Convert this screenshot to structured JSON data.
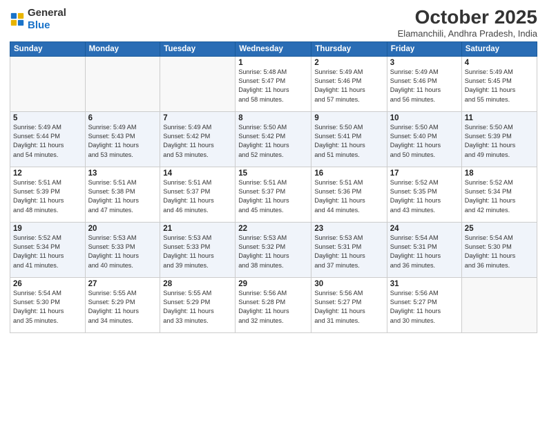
{
  "logo": {
    "general": "General",
    "blue": "Blue"
  },
  "title": "October 2025",
  "subtitle": "Elamanchili, Andhra Pradesh, India",
  "weekdays": [
    "Sunday",
    "Monday",
    "Tuesday",
    "Wednesday",
    "Thursday",
    "Friday",
    "Saturday"
  ],
  "weeks": [
    [
      {
        "day": "",
        "info": ""
      },
      {
        "day": "",
        "info": ""
      },
      {
        "day": "",
        "info": ""
      },
      {
        "day": "1",
        "info": "Sunrise: 5:48 AM\nSunset: 5:47 PM\nDaylight: 11 hours\nand 58 minutes."
      },
      {
        "day": "2",
        "info": "Sunrise: 5:49 AM\nSunset: 5:46 PM\nDaylight: 11 hours\nand 57 minutes."
      },
      {
        "day": "3",
        "info": "Sunrise: 5:49 AM\nSunset: 5:46 PM\nDaylight: 11 hours\nand 56 minutes."
      },
      {
        "day": "4",
        "info": "Sunrise: 5:49 AM\nSunset: 5:45 PM\nDaylight: 11 hours\nand 55 minutes."
      }
    ],
    [
      {
        "day": "5",
        "info": "Sunrise: 5:49 AM\nSunset: 5:44 PM\nDaylight: 11 hours\nand 54 minutes."
      },
      {
        "day": "6",
        "info": "Sunrise: 5:49 AM\nSunset: 5:43 PM\nDaylight: 11 hours\nand 53 minutes."
      },
      {
        "day": "7",
        "info": "Sunrise: 5:49 AM\nSunset: 5:42 PM\nDaylight: 11 hours\nand 53 minutes."
      },
      {
        "day": "8",
        "info": "Sunrise: 5:50 AM\nSunset: 5:42 PM\nDaylight: 11 hours\nand 52 minutes."
      },
      {
        "day": "9",
        "info": "Sunrise: 5:50 AM\nSunset: 5:41 PM\nDaylight: 11 hours\nand 51 minutes."
      },
      {
        "day": "10",
        "info": "Sunrise: 5:50 AM\nSunset: 5:40 PM\nDaylight: 11 hours\nand 50 minutes."
      },
      {
        "day": "11",
        "info": "Sunrise: 5:50 AM\nSunset: 5:39 PM\nDaylight: 11 hours\nand 49 minutes."
      }
    ],
    [
      {
        "day": "12",
        "info": "Sunrise: 5:51 AM\nSunset: 5:39 PM\nDaylight: 11 hours\nand 48 minutes."
      },
      {
        "day": "13",
        "info": "Sunrise: 5:51 AM\nSunset: 5:38 PM\nDaylight: 11 hours\nand 47 minutes."
      },
      {
        "day": "14",
        "info": "Sunrise: 5:51 AM\nSunset: 5:37 PM\nDaylight: 11 hours\nand 46 minutes."
      },
      {
        "day": "15",
        "info": "Sunrise: 5:51 AM\nSunset: 5:37 PM\nDaylight: 11 hours\nand 45 minutes."
      },
      {
        "day": "16",
        "info": "Sunrise: 5:51 AM\nSunset: 5:36 PM\nDaylight: 11 hours\nand 44 minutes."
      },
      {
        "day": "17",
        "info": "Sunrise: 5:52 AM\nSunset: 5:35 PM\nDaylight: 11 hours\nand 43 minutes."
      },
      {
        "day": "18",
        "info": "Sunrise: 5:52 AM\nSunset: 5:34 PM\nDaylight: 11 hours\nand 42 minutes."
      }
    ],
    [
      {
        "day": "19",
        "info": "Sunrise: 5:52 AM\nSunset: 5:34 PM\nDaylight: 11 hours\nand 41 minutes."
      },
      {
        "day": "20",
        "info": "Sunrise: 5:53 AM\nSunset: 5:33 PM\nDaylight: 11 hours\nand 40 minutes."
      },
      {
        "day": "21",
        "info": "Sunrise: 5:53 AM\nSunset: 5:33 PM\nDaylight: 11 hours\nand 39 minutes."
      },
      {
        "day": "22",
        "info": "Sunrise: 5:53 AM\nSunset: 5:32 PM\nDaylight: 11 hours\nand 38 minutes."
      },
      {
        "day": "23",
        "info": "Sunrise: 5:53 AM\nSunset: 5:31 PM\nDaylight: 11 hours\nand 37 minutes."
      },
      {
        "day": "24",
        "info": "Sunrise: 5:54 AM\nSunset: 5:31 PM\nDaylight: 11 hours\nand 36 minutes."
      },
      {
        "day": "25",
        "info": "Sunrise: 5:54 AM\nSunset: 5:30 PM\nDaylight: 11 hours\nand 36 minutes."
      }
    ],
    [
      {
        "day": "26",
        "info": "Sunrise: 5:54 AM\nSunset: 5:30 PM\nDaylight: 11 hours\nand 35 minutes."
      },
      {
        "day": "27",
        "info": "Sunrise: 5:55 AM\nSunset: 5:29 PM\nDaylight: 11 hours\nand 34 minutes."
      },
      {
        "day": "28",
        "info": "Sunrise: 5:55 AM\nSunset: 5:29 PM\nDaylight: 11 hours\nand 33 minutes."
      },
      {
        "day": "29",
        "info": "Sunrise: 5:56 AM\nSunset: 5:28 PM\nDaylight: 11 hours\nand 32 minutes."
      },
      {
        "day": "30",
        "info": "Sunrise: 5:56 AM\nSunset: 5:27 PM\nDaylight: 11 hours\nand 31 minutes."
      },
      {
        "day": "31",
        "info": "Sunrise: 5:56 AM\nSunset: 5:27 PM\nDaylight: 11 hours\nand 30 minutes."
      },
      {
        "day": "",
        "info": ""
      }
    ]
  ]
}
